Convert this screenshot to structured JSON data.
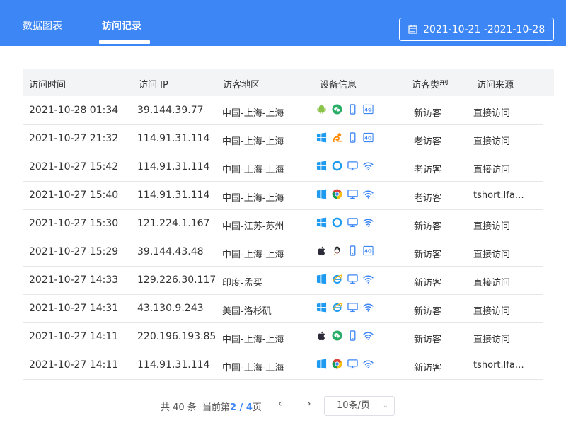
{
  "header": {
    "tabs": [
      {
        "label": "数据图表"
      },
      {
        "label": "访问记录"
      }
    ],
    "date_range": "2021-10-21 -2021-10-28"
  },
  "table": {
    "columns": [
      "访问时间",
      "访问 IP",
      "访客地区",
      "设备信息",
      "访客类型",
      "访问来源"
    ],
    "rows": [
      {
        "time": "2021-10-28 01:34",
        "ip": "39.144.39.77",
        "region": "中国-上海-上海",
        "type": "新访客",
        "source": "直接访问",
        "icons": [
          "android-icon",
          "wechat-icon",
          "mobile-icon",
          "4g-icon"
        ]
      },
      {
        "time": "2021-10-27 21:32",
        "ip": "114.91.31.114",
        "region": "中国-上海-上海",
        "type": "老访客",
        "source": "直接访问",
        "icons": [
          "windows-icon",
          "uc-browser-icon",
          "mobile-icon",
          "4g-icon"
        ]
      },
      {
        "time": "2021-10-27 15:42",
        "ip": "114.91.31.114",
        "region": "中国-上海-上海",
        "type": "老访客",
        "source": "直接访问",
        "icons": [
          "windows-icon",
          "edge-icon",
          "desktop-icon",
          "wifi-icon"
        ]
      },
      {
        "time": "2021-10-27 15:40",
        "ip": "114.91.31.114",
        "region": "中国-上海-上海",
        "type": "老访客",
        "source": "tshort.lfa…",
        "icons": [
          "windows-icon",
          "chrome-icon",
          "desktop-icon",
          "wifi-icon"
        ]
      },
      {
        "time": "2021-10-27 15:30",
        "ip": "121.224.1.167",
        "region": "中国-江苏-苏州",
        "type": "新访客",
        "source": "直接访问",
        "icons": [
          "windows-icon",
          "edge-icon",
          "desktop-icon",
          "wifi-icon"
        ]
      },
      {
        "time": "2021-10-27 15:29",
        "ip": "39.144.43.48",
        "region": "中国-上海-上海",
        "type": "新访客",
        "source": "直接访问",
        "icons": [
          "apple-icon",
          "qq-icon",
          "mobile-icon",
          "4g-icon"
        ]
      },
      {
        "time": "2021-10-27 14:33",
        "ip": "129.226.30.117",
        "region": "印度-孟买",
        "type": "新访客",
        "source": "直接访问",
        "icons": [
          "windows-icon",
          "ie-icon",
          "desktop-icon",
          "wifi-icon"
        ]
      },
      {
        "time": "2021-10-27 14:31",
        "ip": "43.130.9.243",
        "region": "美国-洛杉矶",
        "type": "新访客",
        "source": "直接访问",
        "icons": [
          "windows-icon",
          "ie-icon",
          "desktop-icon",
          "wifi-icon"
        ]
      },
      {
        "time": "2021-10-27 14:11",
        "ip": "220.196.193.85",
        "region": "中国-上海-上海",
        "type": "新访客",
        "source": "直接访问",
        "icons": [
          "apple-icon",
          "wechat-icon",
          "mobile-icon",
          "wifi-icon"
        ]
      },
      {
        "time": "2021-10-27 14:11",
        "ip": "114.91.31.114",
        "region": "中国-上海-上海",
        "type": "新访客",
        "source": "tshort.lfa…",
        "icons": [
          "windows-icon",
          "chrome-icon",
          "desktop-icon",
          "wifi-icon"
        ]
      }
    ]
  },
  "pagination": {
    "total_text": "共 40 条",
    "current_prefix": "当前第",
    "current_page": "2",
    "separator": " / ",
    "total_pages": "4",
    "current_suffix": "页",
    "prev": "‹",
    "next": "›",
    "page_size": "10条/页"
  },
  "colors": {
    "accent": "#3d86f5",
    "header_bg": "#3d86f5"
  }
}
